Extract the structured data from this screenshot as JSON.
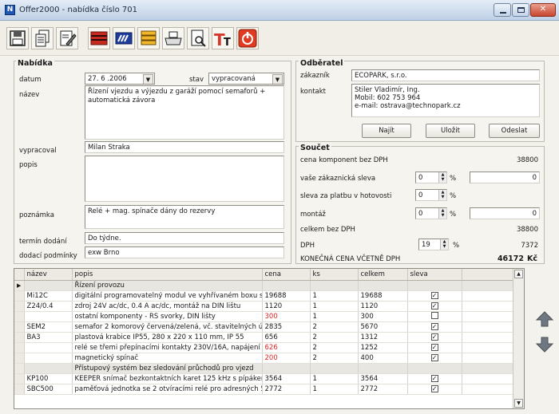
{
  "window": {
    "title": "Offer2000 - nabídka číslo 701",
    "icon_letter": "N"
  },
  "toolbar": {
    "icons": [
      "save-icon",
      "copy-icon",
      "edit-icon",
      "library-icon",
      "card-icon",
      "stack-icon",
      "print-icon",
      "preview-icon",
      "font-icon",
      "power-icon"
    ]
  },
  "nabidka": {
    "title": "Nabídka",
    "datum_label": "datum",
    "datum_value": "27. 6 .2006",
    "stav_label": "stav",
    "stav_value": "vypracovaná",
    "nazev_label": "název",
    "nazev_value": "Řízení vjezdu a výjezdu z garáží pomocí semaforů + automatická závora",
    "vypracoval_label": "vypracoval",
    "vypracoval_value": "Milan Straka",
    "popis_label": "popis",
    "popis_value": "",
    "poznamka_label": "poznámka",
    "poznamka_value": "Relé + mag. spínače dány do rezervy",
    "termin_label": "termín dodání",
    "termin_value": "Do týdne.",
    "dodaci_label": "dodací podmínky",
    "dodaci_value": "exw Brno"
  },
  "odberatel": {
    "title": "Odběratel",
    "zakaznik_label": "zákazník",
    "zakaznik_value": "ECOPARK, s.r.o.",
    "kontakt_label": "kontakt",
    "kontakt_lines": [
      "Stiler Vladimír, Ing.",
      "Mobil: 602 753 964",
      "e-mail: ostrava@technopark.cz"
    ],
    "najit": "Najít",
    "ulozit": "Uložit",
    "odeslat": "Odeslat"
  },
  "soucet": {
    "title": "Součet",
    "cena_bez_label": "cena komponent bez DPH",
    "cena_bez_value": "38800",
    "sleva_label": "vaše zákaznická sleva",
    "sleva_pct": "0",
    "sleva_value": "0",
    "hotovost_label": "sleva za platbu v hotovosti",
    "hotovost_pct": "0",
    "montaz_label": "montáž",
    "montaz_pct": "0",
    "montaz_value": "0",
    "celkem_label": "celkem bez DPH",
    "celkem_value": "38800",
    "dph_label": "DPH",
    "dph_pct": "19",
    "dph_value": "7372",
    "konecna_label": "KONEČNÁ CENA VČETNĚ DPH",
    "konecna_value": "46172",
    "currency": "Kč",
    "pct_sign": "%"
  },
  "table": {
    "headers": [
      "název",
      "popis",
      "cena",
      "ks",
      "celkem",
      "sleva"
    ],
    "rows": [
      {
        "nazev": "",
        "popis": "Řízení provozu",
        "cena": "",
        "ks": "",
        "celkem": "",
        "sleva": null,
        "red": false,
        "current": true
      },
      {
        "nazev": "Mi12C",
        "popis": "digitální programovatelný modul ve vyhřívaném boxu s termostatem",
        "cena": "19688",
        "ks": "1",
        "celkem": "19688",
        "sleva": true,
        "red": false
      },
      {
        "nazev": "Z24/0.4",
        "popis": "zdroj 24V ac/dc, 0.4 A ac/dc, montáž na DIN lištu",
        "cena": "1120",
        "ks": "1",
        "celkem": "1120",
        "sleva": true,
        "red": false
      },
      {
        "nazev": "",
        "popis": "ostatní komponenty - RS svorky, DIN lišty",
        "cena": "300",
        "ks": "1",
        "celkem": "300",
        "sleva": false,
        "red": true
      },
      {
        "nazev": "SEM2",
        "popis": "semafor 2 komorový červená/zelená, vč. stavitelných úchytů na zeď",
        "cena": "2835",
        "ks": "2",
        "celkem": "5670",
        "sleva": true,
        "red": false
      },
      {
        "nazev": "BA3",
        "popis": "plastová krabice IP55, 280 x 220 x 110 mm, IP 55",
        "cena": "656",
        "ks": "2",
        "celkem": "1312",
        "sleva": true,
        "red": false
      },
      {
        "nazev": "",
        "popis": "relé se třemi přepínacími kontakty 230V/16A, napájení 24 nebo 230",
        "cena": "626",
        "ks": "2",
        "celkem": "1252",
        "sleva": true,
        "red": true
      },
      {
        "nazev": "",
        "popis": "magnetický spínač",
        "cena": "200",
        "ks": "2",
        "celkem": "400",
        "sleva": true,
        "red": true
      },
      {
        "nazev": "",
        "popis": "Přístupový systém bez sledování průchodů pro vjezd",
        "cena": "",
        "ks": "",
        "celkem": "",
        "sleva": null,
        "red": false
      },
      {
        "nazev": "KP100",
        "popis": "KEEPER snímač bezkontaktních karet 125 kHz s pípákem a simul",
        "cena": "3564",
        "ks": "1",
        "celkem": "3564",
        "sleva": true,
        "red": false
      },
      {
        "nazev": "SBC500",
        "popis": "paměťová jednotka se 2 otvíracími relé pro adresných 500 uživatel",
        "cena": "2772",
        "ks": "1",
        "celkem": "2772",
        "sleva": true,
        "red": false
      }
    ]
  },
  "colors": {
    "accent": "#1f57b5",
    "red_text": "#e02424",
    "red_icon": "#d73a2a"
  }
}
